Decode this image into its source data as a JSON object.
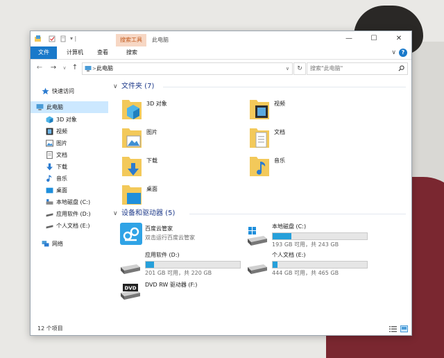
{
  "window": {
    "title": "此电脑",
    "context_tab": "搜索工具",
    "quick_access_separator": "▾ |"
  },
  "ribbon": {
    "tabs": [
      {
        "label": "文件",
        "active": true
      },
      {
        "label": "计算机",
        "active": false
      },
      {
        "label": "查看",
        "active": false
      },
      {
        "label": "搜索",
        "active": false
      }
    ],
    "help": "?",
    "collapse": "∨"
  },
  "navigation": {
    "back": "←",
    "forward": "→",
    "history": "∨",
    "up": "↑",
    "breadcrumb_sep": ">",
    "location": "此电脑",
    "address_dropdown": "∨",
    "refresh": "↻",
    "search_placeholder": "搜索\"此电脑\""
  },
  "sidebar": {
    "items": [
      {
        "label": "快速访问",
        "icon": "star-icon"
      },
      {
        "label": "此电脑",
        "icon": "pc-icon",
        "selected": true
      },
      {
        "label": "3D 对象",
        "icon": "cube-icon"
      },
      {
        "label": "视频",
        "icon": "video-icon"
      },
      {
        "label": "图片",
        "icon": "picture-icon"
      },
      {
        "label": "文档",
        "icon": "document-icon"
      },
      {
        "label": "下载",
        "icon": "download-icon"
      },
      {
        "label": "音乐",
        "icon": "music-icon"
      },
      {
        "label": "桌面",
        "icon": "desktop-icon"
      },
      {
        "label": "本地磁盘 (C:)",
        "icon": "drive-icon"
      },
      {
        "label": "应用软件 (D:)",
        "icon": "drive-icon"
      },
      {
        "label": "个人文档 (E:)",
        "icon": "drive-icon"
      },
      {
        "label": "网络",
        "icon": "network-icon"
      }
    ]
  },
  "folders_section": {
    "header": "文件夹 (7)",
    "items": [
      {
        "label": "3D 对象",
        "icon": "cube-folder-icon"
      },
      {
        "label": "视频",
        "icon": "video-folder-icon"
      },
      {
        "label": "图片",
        "icon": "picture-folder-icon"
      },
      {
        "label": "文档",
        "icon": "document-folder-icon"
      },
      {
        "label": "下载",
        "icon": "download-folder-icon"
      },
      {
        "label": "音乐",
        "icon": "music-folder-icon"
      },
      {
        "label": "桌面",
        "icon": "desktop-folder-icon"
      }
    ]
  },
  "devices_section": {
    "header": "设备和驱动器 (5)",
    "app": {
      "label": "百度云管家",
      "sub": "双击运行百度云管家",
      "icon": "baidu-cloud-icon"
    },
    "drives": [
      {
        "label": "本地磁盘 (C:)",
        "caption": "193 GB 可用，共 243 GB",
        "used_fraction": 0.2,
        "icon": "windows-drive-icon"
      },
      {
        "label": "应用软件 (D:)",
        "caption": "201 GB 可用，共 220 GB",
        "used_fraction": 0.09,
        "icon": "drive-icon"
      },
      {
        "label": "个人文档 (E:)",
        "caption": "444 GB 可用，共 465 GB",
        "used_fraction": 0.05,
        "icon": "drive-icon"
      }
    ],
    "dvd": {
      "label": "DVD RW 驱动器 (F:)",
      "icon": "dvd-drive-icon",
      "badge": "DVD"
    }
  },
  "status": {
    "count": "12 个项目"
  },
  "colors": {
    "accent": "#1979ca",
    "folder": "#f3c95a",
    "selection": "#cce8ff",
    "bar_fill": "#26a0da",
    "context_tab": "#f7d7c4"
  }
}
